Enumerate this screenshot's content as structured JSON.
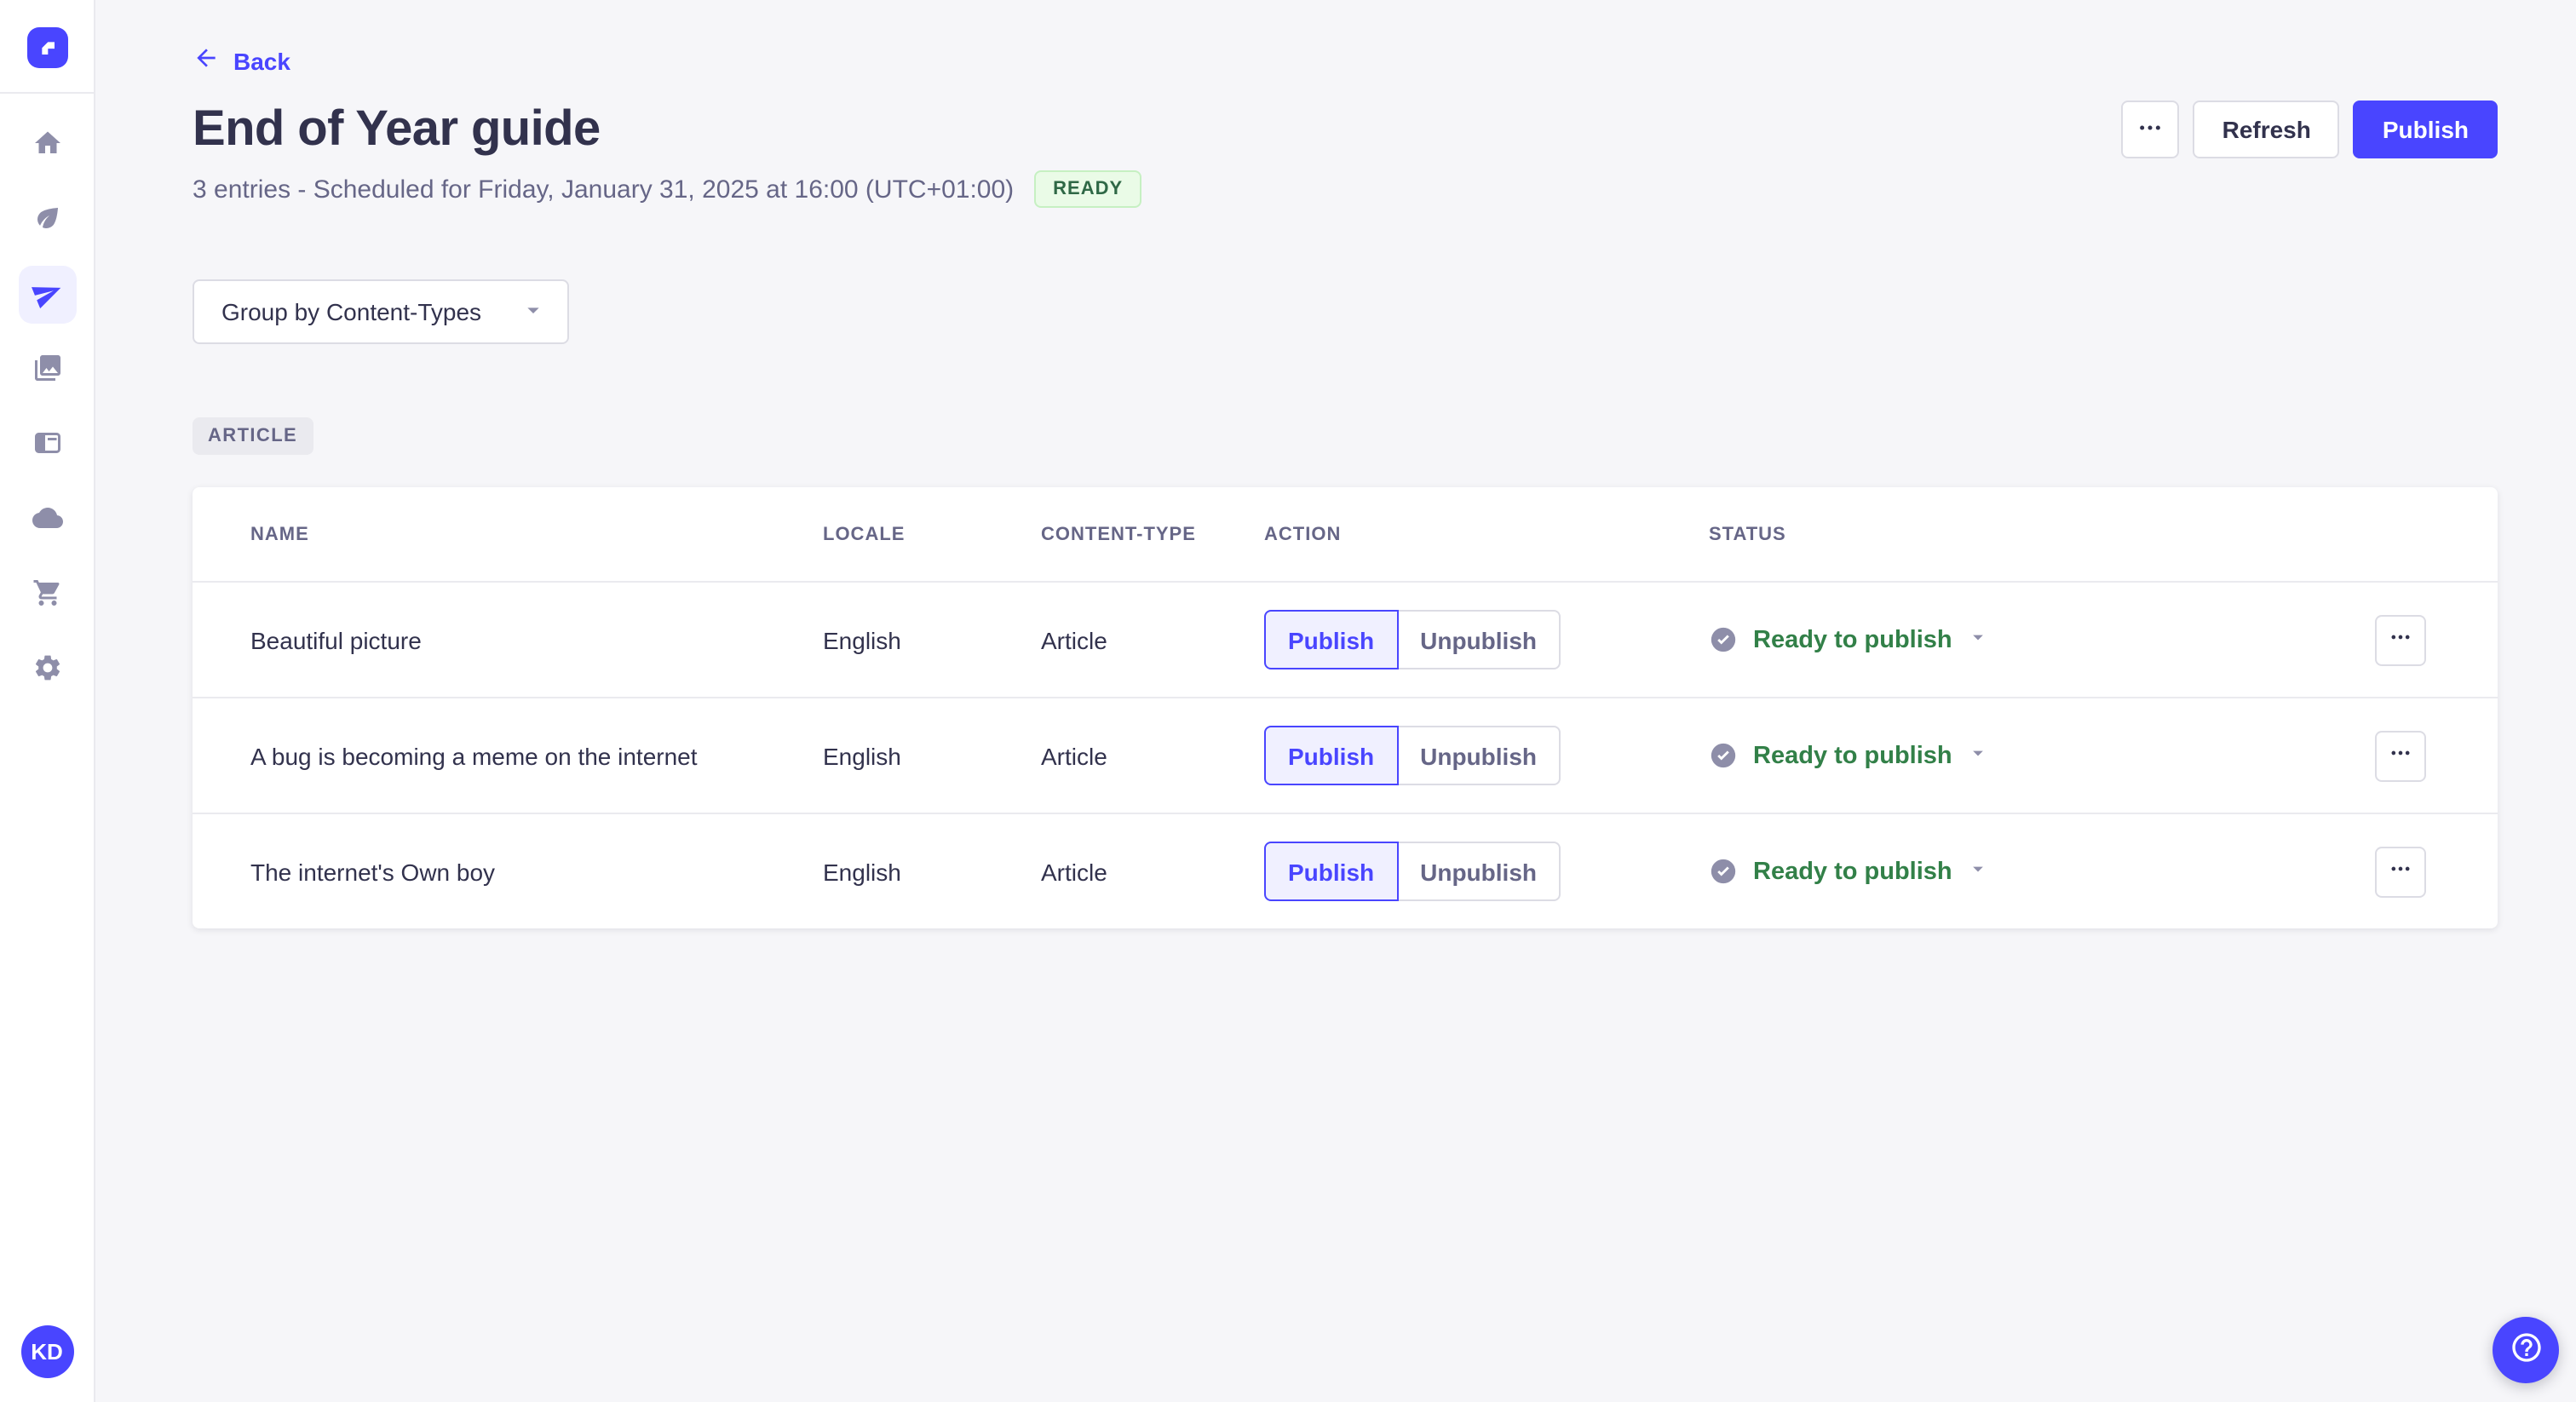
{
  "colors": {
    "primary": "#4945ff",
    "primary_light": "#f0f0ff",
    "success_text": "#2f6846",
    "success_bg": "#eafbe7",
    "status_green": "#328048",
    "neutral_bg": "#f6f6f9",
    "text_dark": "#32324d",
    "text_muted": "#666687",
    "icon_gray": "#8e8ea9"
  },
  "sidebar": {
    "logo_icon": "strapi-logo-icon",
    "items": [
      {
        "id": "home",
        "icon": "home-icon",
        "active": false
      },
      {
        "id": "content-manager",
        "icon": "feather-icon",
        "active": false
      },
      {
        "id": "releases",
        "icon": "paper-plane-icon",
        "active": true
      },
      {
        "id": "media-library",
        "icon": "images-icon",
        "active": false
      },
      {
        "id": "content-type-builder",
        "icon": "layout-icon",
        "active": false
      },
      {
        "id": "cloud",
        "icon": "cloud-icon",
        "active": false
      },
      {
        "id": "marketplace",
        "icon": "cart-icon",
        "active": false
      },
      {
        "id": "settings",
        "icon": "gear-icon",
        "active": false
      }
    ],
    "avatar_initials": "KD"
  },
  "header": {
    "back_label": "Back",
    "title": "End of Year guide",
    "subtitle": "3 entries - Scheduled for Friday, January 31, 2025 at 16:00 (UTC+01:00)",
    "status_badge": "READY",
    "more_icon": "ellipsis-icon",
    "refresh_label": "Refresh",
    "publish_label": "Publish"
  },
  "toolbar": {
    "group_by_label": "Group by Content-Types",
    "caret_icon": "chevron-down-icon"
  },
  "group": {
    "badge": "ARTICLE"
  },
  "table": {
    "columns": [
      "NAME",
      "LOCALE",
      "CONTENT-TYPE",
      "ACTION",
      "STATUS"
    ],
    "actions": {
      "publish": "Publish",
      "unpublish": "Unpublish"
    },
    "rows": [
      {
        "name": "Beautiful picture",
        "locale": "English",
        "content_type": "Article",
        "status": "Ready to publish"
      },
      {
        "name": "A bug is becoming a meme on the internet",
        "locale": "English",
        "content_type": "Article",
        "status": "Ready to publish"
      },
      {
        "name": "The internet's Own boy",
        "locale": "English",
        "content_type": "Article",
        "status": "Ready to publish"
      }
    ]
  },
  "fab": {
    "icon": "help-icon"
  }
}
